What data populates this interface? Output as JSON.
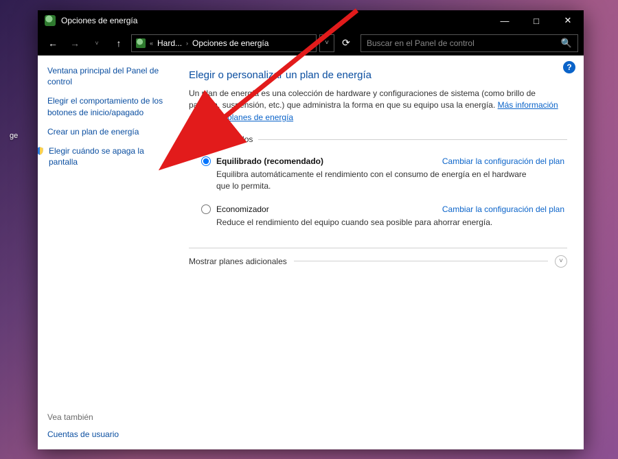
{
  "window": {
    "title": "Opciones de energía",
    "minimize_glyph": "—",
    "maximize_glyph": "□",
    "close_glyph": "✕"
  },
  "desktop": {
    "icon_label": "ge"
  },
  "nav": {
    "back_glyph": "←",
    "forward_glyph": "→",
    "up_glyph": "↑",
    "dropdown_glyph": "˅",
    "refresh_glyph": "⟳",
    "crumb_prefix": "«",
    "crumb1": "Hard...",
    "crumb_sep": "›",
    "crumb2": "Opciones de energía",
    "search_placeholder": "Buscar en el Panel de control",
    "search_glyph": "🔍"
  },
  "sidebar": {
    "items": [
      {
        "label": "Ventana principal del Panel de control"
      },
      {
        "label": "Elegir el comportamiento de los botones de inicio/apagado"
      },
      {
        "label": "Crear un plan de energía"
      },
      {
        "label": "Elegir cuándo se apaga la pantalla"
      }
    ],
    "see_also_header": "Vea también",
    "see_also_link": "Cuentas de usuario"
  },
  "main": {
    "help_glyph": "?",
    "title": "Elegir o personalizar un plan de energía",
    "lead_text": "Un plan de energía es una colección de hardware y configuraciones de sistema (como brillo de pantalla, suspensión, etc.) que administra la forma en que su equipo usa la energía. ",
    "lead_link": "Más información acerca de planes de energía",
    "group_legend": "Planes preferidos",
    "plans": [
      {
        "name": "Equilibrado (recomendado)",
        "desc": "Equilibra automáticamente el rendimiento con el consumo de energía en el hardware que lo permita.",
        "change_label": "Cambiar la configuración del plan",
        "checked": true
      },
      {
        "name": "Economizador",
        "desc": "Reduce el rendimiento del equipo cuando sea posible para ahorrar energía.",
        "change_label": "Cambiar la configuración del plan",
        "checked": false
      }
    ],
    "expander_label": "Mostrar planes adicionales",
    "expander_glyph": "˅"
  }
}
